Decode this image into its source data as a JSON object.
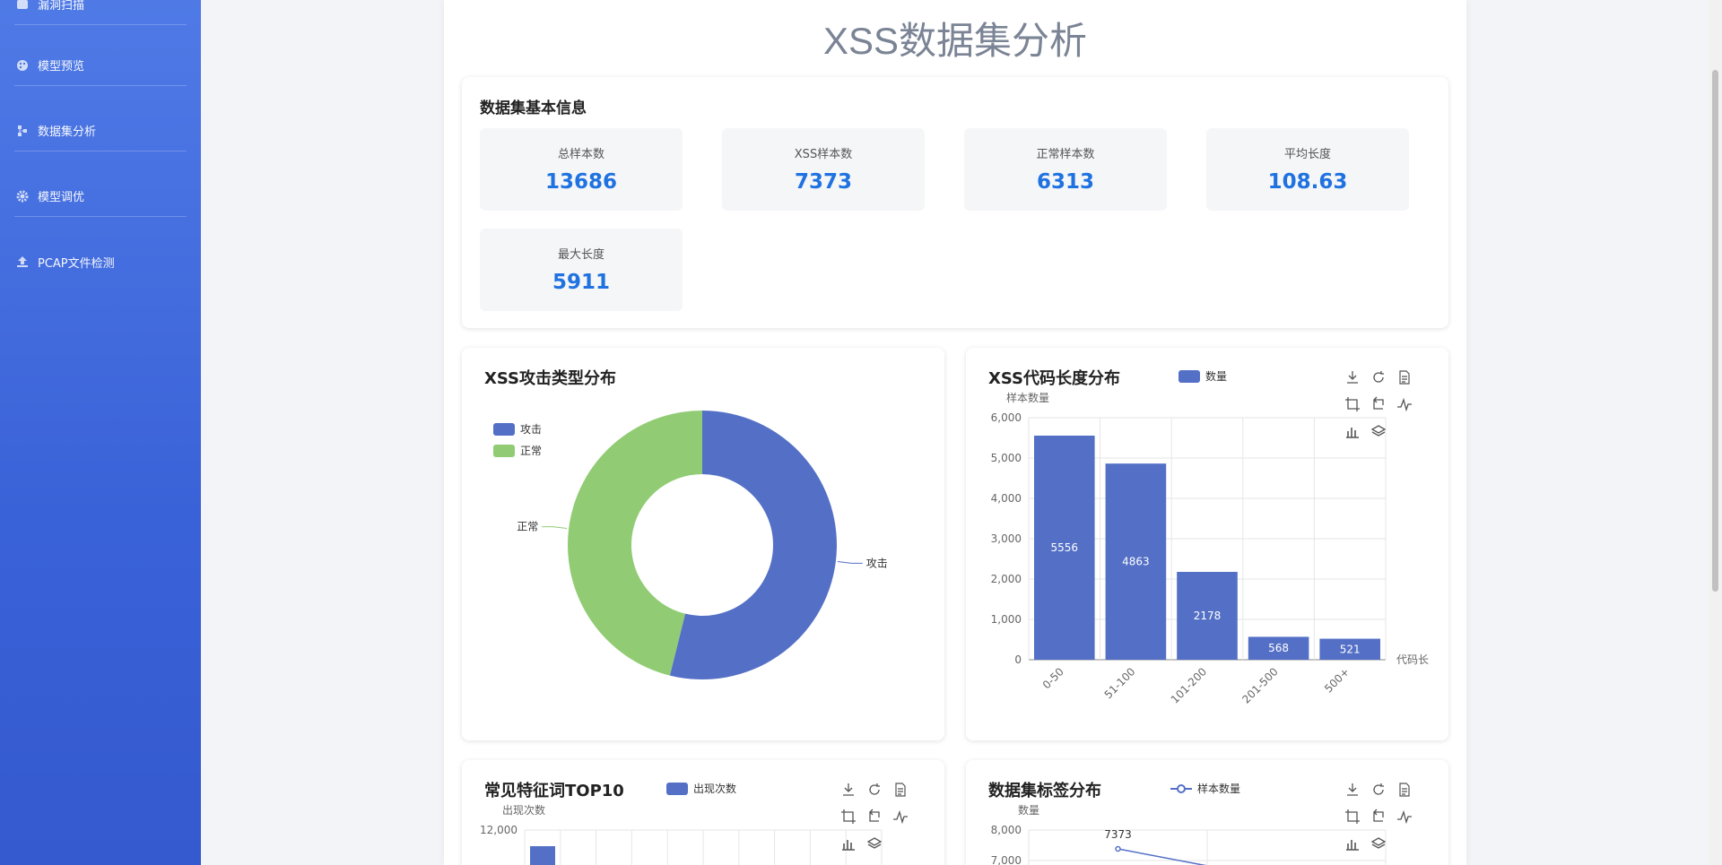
{
  "sidebar": {
    "items": [
      {
        "label": "漏洞扫描",
        "icon": "grid-icon"
      },
      {
        "label": "模型预览",
        "icon": "palette-icon"
      },
      {
        "label": "数据集分析",
        "icon": "tree-icon"
      },
      {
        "label": "模型调优",
        "icon": "gear-icon"
      },
      {
        "label": "PCAP文件检测",
        "icon": "upload-icon"
      }
    ]
  },
  "page": {
    "title": "XSS数据集分析"
  },
  "info": {
    "title": "数据集基本信息",
    "stats": [
      {
        "label": "总样本数",
        "value": "13686"
      },
      {
        "label": "XSS样本数",
        "value": "7373"
      },
      {
        "label": "正常样本数",
        "value": "6313"
      },
      {
        "label": "平均长度",
        "value": "108.63"
      },
      {
        "label": "最大长度",
        "value": "5911"
      }
    ]
  },
  "colors": {
    "blue": "#5470c6",
    "green": "#91cc75",
    "accent": "#1f72e0"
  },
  "charts": {
    "pie": {
      "title": "XSS攻击类型分布",
      "chart_data": {
        "type": "pie",
        "donut": true,
        "slices": [
          {
            "name": "攻击",
            "value": 7373,
            "color": "#5470c6"
          },
          {
            "name": "正常",
            "value": 6313,
            "color": "#91cc75"
          }
        ],
        "legend": [
          "攻击",
          "正常"
        ],
        "legend_position": "top-left"
      }
    },
    "length": {
      "title": "XSS代码长度分布",
      "chart_data": {
        "type": "bar",
        "categories": [
          "0-50",
          "51-100",
          "101-200",
          "201-500",
          "500+"
        ],
        "series": [
          {
            "name": "数量",
            "values": [
              5556,
              4863,
              2178,
              568,
              521
            ]
          }
        ],
        "ylabel": "样本数量",
        "xlabel": "代码长",
        "ylim": [
          0,
          6000
        ],
        "yticks": [
          "0",
          "1,000",
          "2,000",
          "3,000",
          "4,000",
          "5,000",
          "6,000"
        ],
        "grid": true,
        "legend_position": "top"
      }
    },
    "features": {
      "title": "常见特征词TOP10",
      "chart_data": {
        "type": "bar",
        "series": [
          {
            "name": "出现次数"
          }
        ],
        "ylabel": "出现次数",
        "yticks": [
          "12,000"
        ],
        "grid": true,
        "legend_position": "top"
      }
    },
    "labels": {
      "title": "数据集标签分布",
      "chart_data": {
        "type": "line",
        "series": [
          {
            "name": "样本数量"
          }
        ],
        "ylabel": "数量",
        "yticks": [
          "8,000",
          "7,000"
        ],
        "data_labels": [
          "7373"
        ],
        "grid": true,
        "legend_position": "top"
      }
    }
  },
  "toolbox": [
    "download-icon",
    "refresh-icon",
    "data-view-icon",
    "zoom-icon",
    "zoom-reset-icon",
    "line-icon",
    "bar-icon",
    "stack-icon"
  ]
}
